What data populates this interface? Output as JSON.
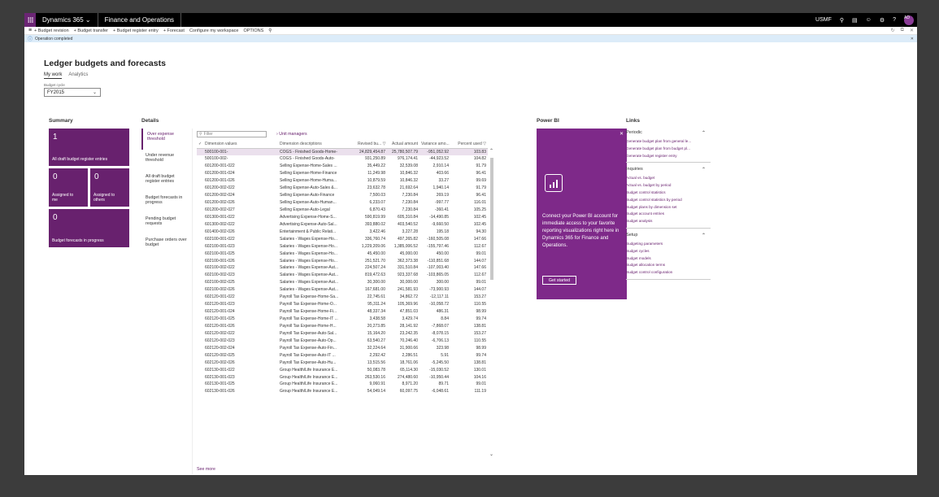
{
  "topbar": {
    "app_name": "Dynamics 365",
    "module_name": "Finance and Operations",
    "company": "USMF",
    "avatar_initials": "AD"
  },
  "actionbar": {
    "actions": [
      "+ Budget revision",
      "+ Budget transfer",
      "+ Budget register entry",
      "+ Forecast",
      "Configure my workspace",
      "OPTIONS"
    ]
  },
  "message": {
    "text": "Operation completed"
  },
  "page": {
    "title": "Ledger budgets and forecasts",
    "tabs": [
      "My work",
      "Analytics"
    ],
    "budget_cycle_label": "Budget cycle",
    "budget_cycle_value": "FY2015"
  },
  "summary": {
    "title": "Summary",
    "tiles": [
      {
        "count": "1",
        "label": "All draft budget register entries"
      },
      {
        "count": "0",
        "label": "Assigned to me"
      },
      {
        "count": "0",
        "label": "Assigned to others"
      },
      {
        "count": "0",
        "label": "Budget forecasts in progress"
      }
    ]
  },
  "details": {
    "title": "Details",
    "menu": [
      "Over expense threshold",
      "Under revenue threshold",
      "All draft budget register entries",
      "Budget forecasts in progress",
      "Pending budget requests",
      "Purchase orders over budget"
    ],
    "filter_placeholder": "Filter",
    "unit_managers": "Unit managers",
    "columns": [
      "Dimension values",
      "Dimension descriptions",
      "Revised bu...",
      "Actual amount",
      "Variance amo...",
      "Percent used"
    ],
    "rows": [
      [
        "500100-001-",
        "COGS - Finished Goods-Home-",
        "24,829,454.87",
        "25,780,507.79",
        "-951,052.92",
        "103.83"
      ],
      [
        "500100-002-",
        "COGS - Finished Goods-Auto-",
        "931,250.89",
        "976,174.41",
        "-44,923.52",
        "104.82"
      ],
      [
        "601200-001-022",
        "Selling Expense-Home-Sales ...",
        "35,449.22",
        "32,539.08",
        "2,910.14",
        "91.79"
      ],
      [
        "601200-001-024",
        "Selling Expense-Home-Finance",
        "11,249.98",
        "10,846.32",
        "403.66",
        "96.41"
      ],
      [
        "601200-001-026",
        "Selling Expense-Home-Huma...",
        "10,879.59",
        "10,846.32",
        "33.27",
        "99.69"
      ],
      [
        "601200-002-022",
        "Selling Expense-Auto-Sales &...",
        "23,632.78",
        "21,692.64",
        "1,940.14",
        "91.79"
      ],
      [
        "601200-002-024",
        "Selling Expense-Auto-Finance",
        "7,500.03",
        "7,230.84",
        "269.19",
        "96.41"
      ],
      [
        "601200-002-026",
        "Selling Expense-Auto-Human...",
        "6,233.07",
        "7,230.84",
        "-997.77",
        "116.01"
      ],
      [
        "601200-002-027",
        "Selling Expense-Auto-Legal",
        "6,870.43",
        "7,230.84",
        "-360.41",
        "105.25"
      ],
      [
        "601300-001-022",
        "Advertising Expense-Home-S...",
        "590,819.99",
        "605,310.84",
        "-14,490.85",
        "102.45"
      ],
      [
        "601300-002-022",
        "Advertising Expense-Auto-Sal...",
        "393,880.02",
        "403,540.52",
        "-9,660.50",
        "102.45"
      ],
      [
        "601400-002-026",
        "Entertainment & Public Relati...",
        "3,422.46",
        "3,227.28",
        "195.18",
        "94.30"
      ],
      [
        "602100-001-022",
        "Salaries - Wages Expense-Ho...",
        "336,760.74",
        "497,265.82",
        "-160,505.08",
        "147.66"
      ],
      [
        "602100-001-023",
        "Salaries - Wages Expense-Ho...",
        "1,229,209.06",
        "1,385,006.52",
        "-155,797.46",
        "112.67"
      ],
      [
        "602100-001-025",
        "Salaries - Wages Expense-Ho...",
        "45,450.00",
        "45,000.00",
        "450.00",
        "99.01"
      ],
      [
        "602100-001-026",
        "Salaries - Wages Expense-Ho...",
        "251,521.70",
        "362,373.38",
        "-110,851.68",
        "144.07"
      ],
      [
        "602100-002-022",
        "Salaries - Wages Expense-Aut...",
        "224,507.24",
        "331,510.84",
        "-107,003.40",
        "147.66"
      ],
      [
        "602100-002-023",
        "Salaries - Wages Expense-Aut...",
        "819,472.63",
        "923,337.68",
        "-103,865.05",
        "112.67"
      ],
      [
        "602100-002-025",
        "Salaries - Wages Expense-Aut...",
        "30,300.00",
        "30,000.00",
        "300.00",
        "99.01"
      ],
      [
        "602100-002-026",
        "Salaries - Wages Expense-Aut...",
        "167,681.00",
        "241,581.93",
        "-73,900.93",
        "144.07"
      ],
      [
        "602120-001-022",
        "Payroll Tax Expense-Home-Sa...",
        "22,745.61",
        "34,862.72",
        "-12,117.11",
        "153.27"
      ],
      [
        "602120-001-023",
        "Payroll Tax Expense-Home-O...",
        "95,311.24",
        "105,369.96",
        "-10,058.72",
        "110.55"
      ],
      [
        "602120-001-024",
        "Payroll Tax Expense-Home-Fi...",
        "48,337.34",
        "47,851.03",
        "486.31",
        "98.99"
      ],
      [
        "602120-001-025",
        "Payroll Tax Expense-Home-IT ...",
        "3,438.58",
        "3,429.74",
        "8.84",
        "99.74"
      ],
      [
        "602120-001-026",
        "Payroll Tax Expense-Home-H...",
        "20,273.85",
        "28,141.92",
        "-7,868.07",
        "138.81"
      ],
      [
        "602120-002-022",
        "Payroll Tax Expense-Auto-Sal...",
        "15,164.20",
        "23,242.35",
        "-8,078.15",
        "153.27"
      ],
      [
        "602120-002-023",
        "Payroll Tax Expense-Auto-Op...",
        "63,540.27",
        "70,246.40",
        "-6,706.13",
        "110.55"
      ],
      [
        "602120-002-024",
        "Payroll Tax Expense-Auto-Fin...",
        "32,224.64",
        "31,900.66",
        "323.98",
        "98.99"
      ],
      [
        "602120-002-025",
        "Payroll Tax Expense-Auto-IT ...",
        "2,292.42",
        "2,286.51",
        "5.91",
        "99.74"
      ],
      [
        "602120-002-026",
        "Payroll Tax Expense-Auto-Hu...",
        "13,515.56",
        "18,761.06",
        "-5,245.50",
        "138.81"
      ],
      [
        "602130-001-022",
        "Group Health/Life Insurance E...",
        "50,083.78",
        "65,114.30",
        "-15,030.52",
        "130.01"
      ],
      [
        "602130-001-023",
        "Group Health/Life Insurance E...",
        "263,530.16",
        "274,480.60",
        "-10,950.44",
        "104.16"
      ],
      [
        "602130-001-025",
        "Group Health/Life Insurance E...",
        "9,060.91",
        "8,971.20",
        "89.71",
        "99.01"
      ],
      [
        "602130-001-026",
        "Group Health/Life Insurance E...",
        "54,049.14",
        "60,097.75",
        "-6,048.61",
        "111.19"
      ]
    ],
    "see_more": "See more"
  },
  "powerbi": {
    "title": "Power BI",
    "text": "Connect your Power BI account for immediate access to your favorite reporting visualizations right here in Dynamics 365 for Finance and Operations.",
    "button": "Get started"
  },
  "links": {
    "title": "Links",
    "groups": [
      {
        "name": "Periodic",
        "items": [
          "Generate budget plan from general le...",
          "Generate budget plan from budget pl...",
          "Generate budget register entry"
        ]
      },
      {
        "name": "Inquiries",
        "items": [
          "Actual vs. budget",
          "Actual vs. budget by period",
          "Budget control statistics",
          "Budget control statistics by period",
          "Budget plans by dimension set",
          "Budget account entries",
          "Budget analysis"
        ]
      },
      {
        "name": "Setup",
        "items": [
          "Budgeting parameters",
          "Budget cycles",
          "Budget models",
          "Budget allocation terms",
          "Budget control configuration"
        ]
      }
    ]
  }
}
